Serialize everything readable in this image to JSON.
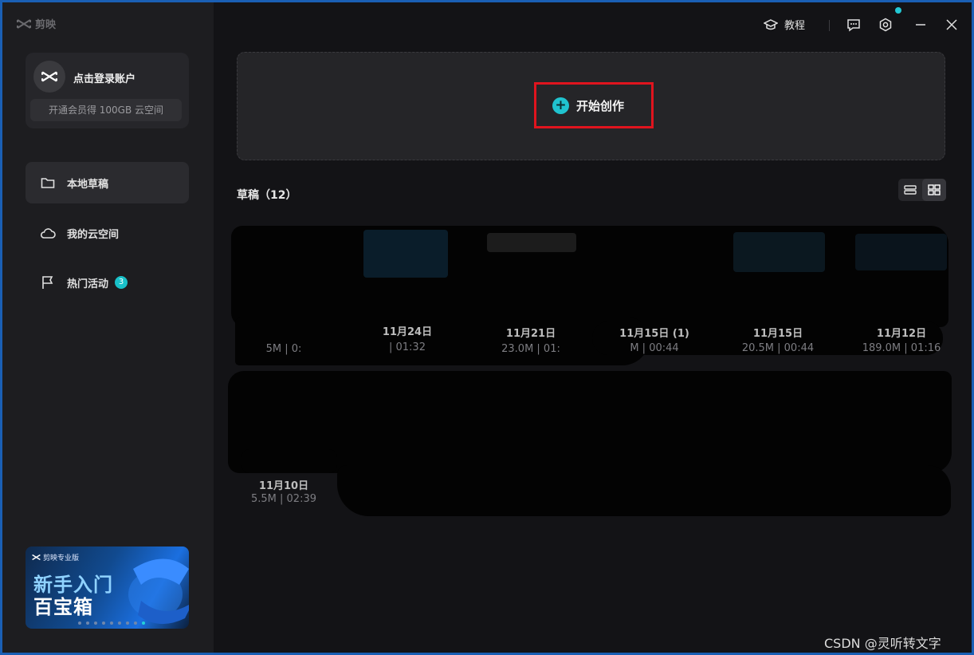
{
  "app": {
    "logo_text": "剪映"
  },
  "titlebar": {
    "tutorial_label": "教程"
  },
  "account": {
    "login_label": "点击登录账户",
    "vip_text": "开通会员得 100GB 云空间"
  },
  "sidebar": {
    "items": [
      {
        "label": "本地草稿",
        "icon": "folder-icon",
        "active": true
      },
      {
        "label": "我的云空间",
        "icon": "cloud-icon",
        "active": false
      },
      {
        "label": "热门活动",
        "icon": "flag-icon",
        "active": false,
        "badge": "3"
      }
    ]
  },
  "promo": {
    "brand": "剪映专业版",
    "line1": "新手入门",
    "line2": "百宝箱"
  },
  "main": {
    "create_label": "开始创作",
    "drafts_title": "草稿（12）"
  },
  "drafts_row1": [
    {
      "date": "",
      "meta": "5M | 0:"
    },
    {
      "date": "11月24日",
      "meta": "| 01:32"
    },
    {
      "date": "11月21日",
      "meta": "23.0M | 01:"
    },
    {
      "date": "11月15日 (1)",
      "meta": "M | 00:44"
    },
    {
      "date": "11月15日",
      "meta": "20.5M | 00:44"
    },
    {
      "date": "11月12日",
      "meta": "189.0M | 01:16"
    }
  ],
  "drafts_row2": [
    {
      "date": "11月10日",
      "meta": "5.5M | 02:39"
    }
  ],
  "watermark": "CSDN @灵听转文字",
  "colors": {
    "accent": "#20c3cf",
    "highlight_box": "#e0141e",
    "background": "#131316",
    "sidebar": "#1d1d20"
  }
}
